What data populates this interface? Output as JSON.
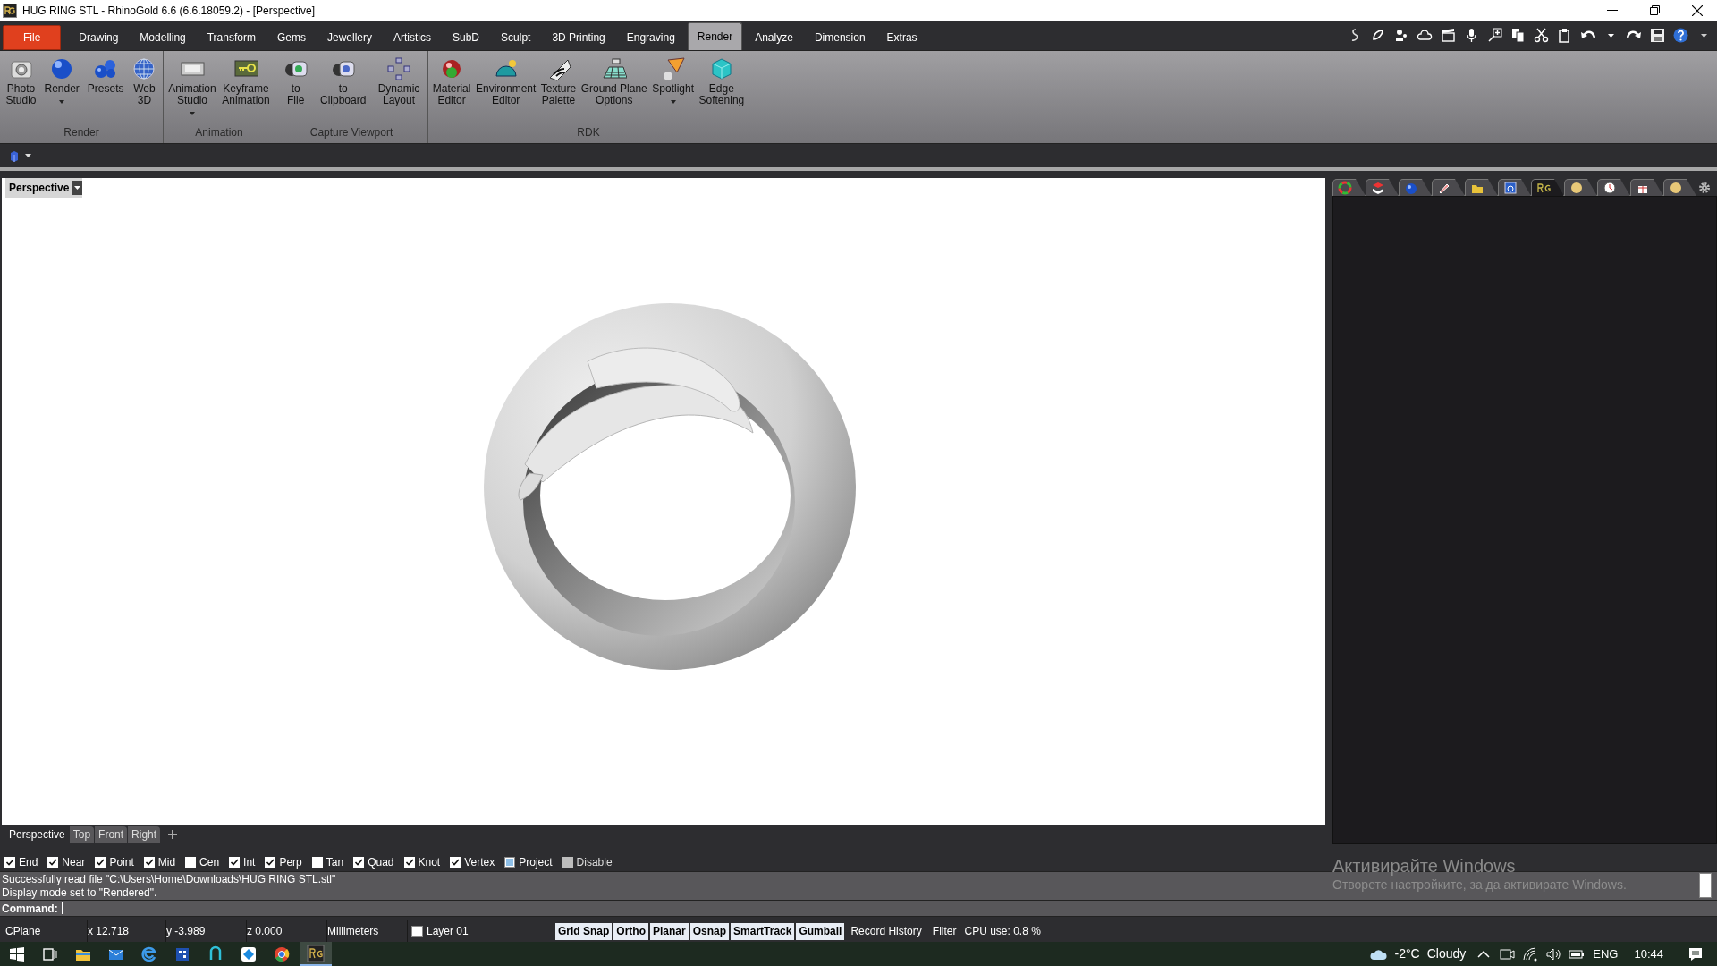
{
  "window": {
    "title": "HUG RING STL - RhinoGold 6.6 (6.6.18059.2) - [Perspective]"
  },
  "menu_tabs": [
    {
      "label": "File",
      "kind": "file",
      "selected": false
    },
    {
      "label": "Drawing",
      "kind": "tab",
      "selected": false
    },
    {
      "label": "Modelling",
      "kind": "tab",
      "selected": false
    },
    {
      "label": "Transform",
      "kind": "tab",
      "selected": false
    },
    {
      "label": "Gems",
      "kind": "tab",
      "selected": false
    },
    {
      "label": "Jewellery",
      "kind": "tab",
      "selected": false
    },
    {
      "label": "Artistics",
      "kind": "tab",
      "selected": false
    },
    {
      "label": "SubD",
      "kind": "tab",
      "selected": false
    },
    {
      "label": "Sculpt",
      "kind": "tab",
      "selected": false
    },
    {
      "label": "3D Printing",
      "kind": "tab",
      "selected": false
    },
    {
      "label": "Engraving",
      "kind": "tab",
      "selected": false
    },
    {
      "label": "Render",
      "kind": "tab",
      "selected": true
    },
    {
      "label": "Analyze",
      "kind": "tab",
      "selected": false
    },
    {
      "label": "Dimension",
      "kind": "tab",
      "selected": false
    },
    {
      "label": "Extras",
      "kind": "tab",
      "selected": false
    }
  ],
  "ribbon_groups": [
    {
      "label": "Render",
      "buttons": [
        {
          "label": "Photo Studio",
          "dropdown": false
        },
        {
          "label": "Render",
          "dropdown": true
        },
        {
          "label": "Presets",
          "dropdown": false
        },
        {
          "label": "Web 3D",
          "dropdown": false
        }
      ]
    },
    {
      "label": "Animation",
      "buttons": [
        {
          "label": "Animation Studio",
          "dropdown": true
        },
        {
          "label": "Keyframe Animation",
          "dropdown": false
        }
      ]
    },
    {
      "label": "Capture Viewport",
      "buttons": [
        {
          "label": "to File",
          "dropdown": false
        },
        {
          "label": "to Clipboard",
          "dropdown": false
        },
        {
          "label": "Dynamic Layout",
          "dropdown": false
        }
      ]
    },
    {
      "label": "RDK",
      "buttons": [
        {
          "label": "Material Editor",
          "dropdown": false
        },
        {
          "label": "Environment Editor",
          "dropdown": false
        },
        {
          "label": "Texture Palette",
          "dropdown": false
        },
        {
          "label": "Ground Plane Options",
          "dropdown": false
        },
        {
          "label": "Spotlight",
          "dropdown": true
        },
        {
          "label": "Edge Softening",
          "dropdown": false
        }
      ]
    }
  ],
  "viewport": {
    "title": "Perspective"
  },
  "panel_tabs": [
    {
      "selected": false
    },
    {
      "selected": false
    },
    {
      "selected": false
    },
    {
      "selected": false
    },
    {
      "selected": false
    },
    {
      "selected": false
    },
    {
      "selected": true
    },
    {
      "selected": false
    },
    {
      "selected": false
    },
    {
      "selected": false
    },
    {
      "selected": false
    }
  ],
  "viewport_tabs": [
    {
      "label": "Perspective",
      "selected": true
    },
    {
      "label": "Top",
      "selected": false
    },
    {
      "label": "Front",
      "selected": false
    },
    {
      "label": "Right",
      "selected": false
    }
  ],
  "osnaps": [
    {
      "label": "End",
      "kind": "snap",
      "checked": true
    },
    {
      "label": "Near",
      "kind": "snap",
      "checked": true
    },
    {
      "label": "Point",
      "kind": "snap",
      "checked": true
    },
    {
      "label": "Mid",
      "kind": "snap",
      "checked": true
    },
    {
      "label": "Cen",
      "kind": "snap",
      "checked": false
    },
    {
      "label": "Int",
      "kind": "snap",
      "checked": true
    },
    {
      "label": "Perp",
      "kind": "snap",
      "checked": true
    },
    {
      "label": "Tan",
      "kind": "snap",
      "checked": false
    },
    {
      "label": "Quad",
      "kind": "snap",
      "checked": true
    },
    {
      "label": "Knot",
      "kind": "snap",
      "checked": true
    },
    {
      "label": "Vertex",
      "kind": "snap",
      "checked": true
    },
    {
      "label": "Project",
      "kind": "mode",
      "checked": true
    },
    {
      "label": "Disable",
      "kind": "disable",
      "checked": false
    }
  ],
  "command_history": [
    "Successfully read file \"C:\\Users\\Home\\Downloads\\HUG RING STL.stl\"",
    "Display mode set to \"Rendered\"."
  ],
  "command_prompt": "Command:",
  "watermark": {
    "title": "Активирайте Windows",
    "subtitle": "Отворете настройките, за да активирате Windows."
  },
  "status_bar": {
    "cplane": "CPlane",
    "x": "x 12.718",
    "y": "y -3.989",
    "z": "z 0.000",
    "units": "Millimeters",
    "layer": {
      "label": "Layer 01",
      "color": "#ffffff"
    },
    "toggles": [
      {
        "label": "Grid Snap",
        "on": true
      },
      {
        "label": "Ortho",
        "on": true
      },
      {
        "label": "Planar",
        "on": true
      },
      {
        "label": "Osnap",
        "on": true
      },
      {
        "label": "SmartTrack",
        "on": true
      },
      {
        "label": "Gumball",
        "on": true
      },
      {
        "label": "Record History",
        "on": false
      },
      {
        "label": "Filter",
        "on": false
      }
    ],
    "cpu": "CPU use: 0.8 %"
  },
  "taskbar": {
    "temperature": "-2°C",
    "weather": "Cloudy",
    "language": "ENG",
    "time": "10:44"
  }
}
